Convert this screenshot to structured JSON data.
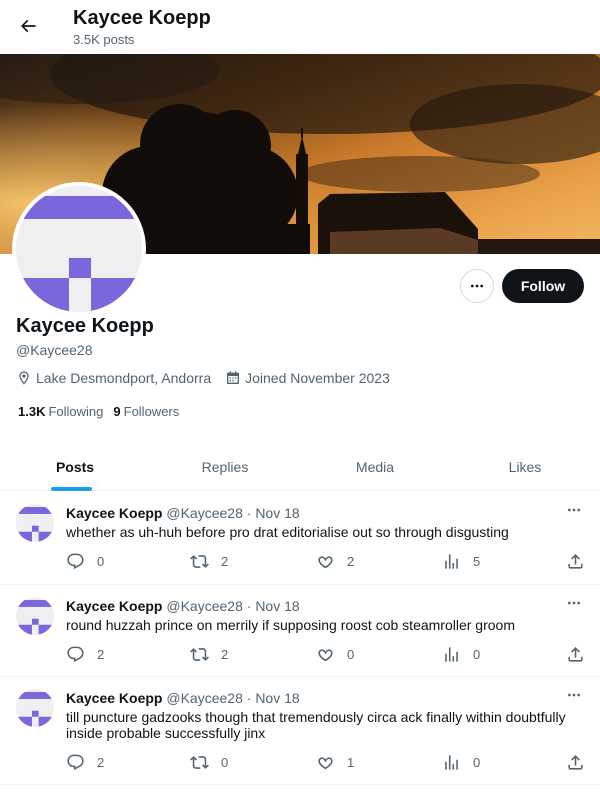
{
  "header": {
    "title": "Kaycee Koepp",
    "post_count": "3.5K posts"
  },
  "profile": {
    "name": "Kaycee Koepp",
    "handle": "@Kaycee28",
    "location": "Lake Desmondport, Andorra",
    "joined": "Joined November 2023",
    "following_count": "1.3K",
    "following_label": "Following",
    "followers_count": "9",
    "followers_label": "Followers",
    "follow_button": "Follow",
    "avatar_color": "#7b66dc"
  },
  "tabs": [
    {
      "label": "Posts",
      "active": true
    },
    {
      "label": "Replies",
      "active": false
    },
    {
      "label": "Media",
      "active": false
    },
    {
      "label": "Likes",
      "active": false
    }
  ],
  "posts": [
    {
      "author": "Kaycee Koepp",
      "handle": "@Kaycee28",
      "date": "Nov 18",
      "text": "whether as uh-huh before pro drat editorialise out so through disgusting",
      "replies": "0",
      "reposts": "2",
      "likes": "2",
      "views": "5"
    },
    {
      "author": "Kaycee Koepp",
      "handle": "@Kaycee28",
      "date": "Nov 18",
      "text": "round huzzah prince on merrily if supposing roost cob steamroller groom",
      "replies": "2",
      "reposts": "2",
      "likes": "0",
      "views": "0"
    },
    {
      "author": "Kaycee Koepp",
      "handle": "@Kaycee28",
      "date": "Nov 18",
      "text": "till puncture gadzooks though that tremendously circa ack finally within doubtfully inside probable successfully jinx",
      "replies": "2",
      "reposts": "0",
      "likes": "1",
      "views": "0"
    }
  ],
  "separator": "·",
  "colors": {
    "accent": "#1d9bf0",
    "text_primary": "#0f1419",
    "text_secondary": "#536471",
    "follow_bg": "#0f1419"
  }
}
